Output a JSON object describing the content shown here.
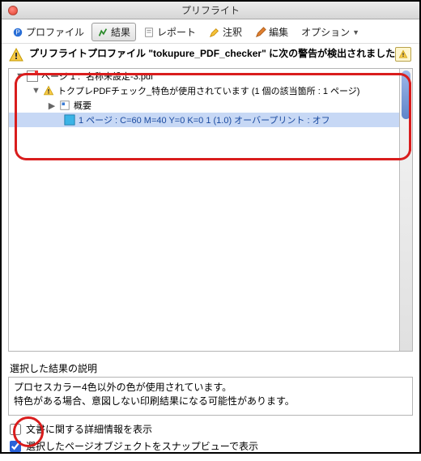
{
  "window": {
    "title": "プリフライト"
  },
  "toolbar": {
    "profile": "プロファイル",
    "result": "結果",
    "report": "レポート",
    "annotation": "注釈",
    "edit": "編集",
    "option": "オプション"
  },
  "summary": {
    "text": "プリフライトプロファイル \"tokupure_PDF_checker\" に次の警告が検出されました :"
  },
  "tree": {
    "page_node": "ページ 1 : \"名称未設定-3.pdf\"",
    "warning_node": "トクプレPDFチェック_特色が使用されています (1 個の該当箇所 : 1 ページ)",
    "overview_node": "概要",
    "detail_node": "1 ページ : C=60 M=40 Y=0 K=0 1 (1.0) オーバープリント : オフ"
  },
  "explain": {
    "label": "選択した結果の説明",
    "line1": "プロセスカラー4色以外の色が使用されています。",
    "line2": "特色がある場合、意図しない印刷結果になる可能性があります。"
  },
  "checks": {
    "doc_info": "文書に関する詳細情報を表示",
    "snap_view": "選択したページオブジェクトをスナップビューで表示"
  }
}
